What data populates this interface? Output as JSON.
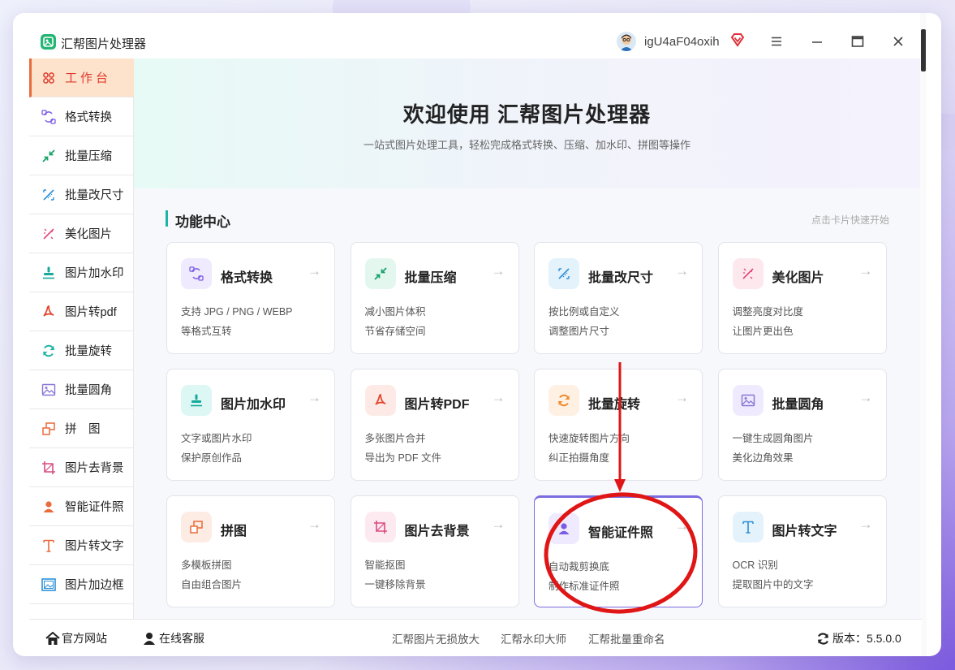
{
  "app": {
    "title": "汇帮图片处理器",
    "username": "igU4aF04oxih"
  },
  "sidebar": {
    "items": [
      {
        "label": "工作台",
        "icon": "grid-icon",
        "active": true
      },
      {
        "label": "格式转换",
        "icon": "convert-icon"
      },
      {
        "label": "批量压缩",
        "icon": "compress-icon"
      },
      {
        "label": "批量改尺寸",
        "icon": "resize-icon"
      },
      {
        "label": "美化图片",
        "icon": "beautify-icon"
      },
      {
        "label": "图片加水印",
        "icon": "stamp-icon"
      },
      {
        "label": "图片转pdf",
        "icon": "pdf-icon"
      },
      {
        "label": "批量旋转",
        "icon": "rotate-icon"
      },
      {
        "label": "批量圆角",
        "icon": "image-icon"
      },
      {
        "label": "拼　图",
        "icon": "collage-icon"
      },
      {
        "label": "图片去背景",
        "icon": "crop-icon"
      },
      {
        "label": "智能证件照",
        "icon": "person-icon"
      },
      {
        "label": "图片转文字",
        "icon": "text-icon"
      },
      {
        "label": "图片加边框",
        "icon": "frame-icon"
      }
    ]
  },
  "hero": {
    "title": "欢迎使用 汇帮图片处理器",
    "subtitle": "一站式图片处理工具，轻松完成格式转换、压缩、加水印、拼图等操作"
  },
  "section": {
    "title": "功能中心",
    "hint": "点击卡片快速开始"
  },
  "cards": [
    {
      "title": "格式转换",
      "d1": "支持 JPG / PNG / WEBP",
      "d2": "等格式互转",
      "icon": "convert-icon",
      "bg": "#efeafd",
      "fg": "#7b5ce6"
    },
    {
      "title": "批量压缩",
      "d1": "减小图片体积",
      "d2": "节省存储空间",
      "icon": "compress-icon",
      "bg": "#e3f7ef",
      "fg": "#1aa36b"
    },
    {
      "title": "批量改尺寸",
      "d1": "按比例或自定义",
      "d2": "调整图片尺寸",
      "icon": "resize-icon",
      "bg": "#e4f2fc",
      "fg": "#2c8fd8"
    },
    {
      "title": "美化图片",
      "d1": "调整亮度对比度",
      "d2": "让图片更出色",
      "icon": "beautify-icon",
      "bg": "#fde8ee",
      "fg": "#e0487a"
    },
    {
      "title": "图片加水印",
      "d1": "文字或图片水印",
      "d2": "保护原创作品",
      "icon": "stamp-icon",
      "bg": "#dcf7f4",
      "fg": "#17a99a"
    },
    {
      "title": "图片转PDF",
      "d1": "多张图片合并",
      "d2": "导出为 PDF 文件",
      "icon": "pdf-icon",
      "bg": "#fdeae6",
      "fg": "#e3442b"
    },
    {
      "title": "批量旋转",
      "d1": "快速旋转图片方向",
      "d2": "纠正拍摄角度",
      "icon": "rotate-icon",
      "bg": "#fef1e4",
      "fg": "#ef8a2c"
    },
    {
      "title": "批量圆角",
      "d1": "一键生成圆角图片",
      "d2": "美化边角效果",
      "icon": "image-icon",
      "bg": "#efeafd",
      "fg": "#8a74d6"
    },
    {
      "title": "拼图",
      "d1": "多模板拼图",
      "d2": "自由组合图片",
      "icon": "collage-icon",
      "bg": "#fdece4",
      "fg": "#ea6a3a"
    },
    {
      "title": "图片去背景",
      "d1": "智能抠图",
      "d2": "一键移除背景",
      "icon": "crop-icon",
      "bg": "#fdeaf1",
      "fg": "#d94b80"
    },
    {
      "title": "智能证件照",
      "d1": "自动裁剪换底",
      "d2": "制作标准证件照",
      "icon": "person-icon",
      "bg": "#efeafd",
      "fg": "#7a5ce0",
      "selected": true
    },
    {
      "title": "图片转文字",
      "d1": "OCR 识别",
      "d2": "提取图片中的文字",
      "icon": "text-icon",
      "bg": "#e4f2fc",
      "fg": "#2c8fd8"
    }
  ],
  "footer": {
    "home": "官方网站",
    "service": "在线客服",
    "links": [
      "汇帮图片无损放大",
      "汇帮水印大师",
      "汇帮批量重命名"
    ],
    "version": "版本：5.5.0.0"
  },
  "colors": {
    "accent": "#1fb3a8",
    "active_bg": "#fde3cc",
    "active_fg": "#e0392b",
    "annotation": "#e01515"
  }
}
